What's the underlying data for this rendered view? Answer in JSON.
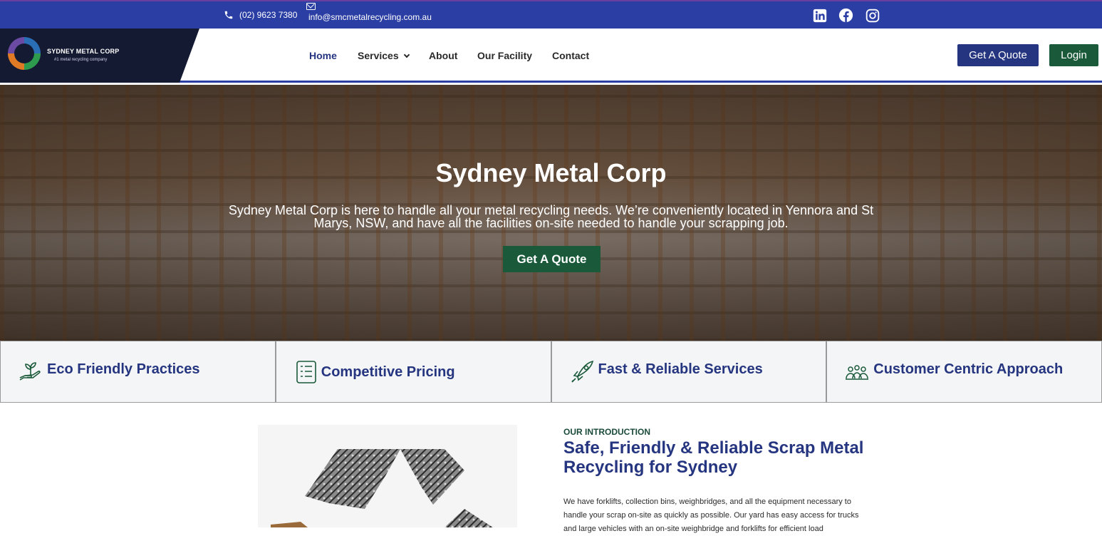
{
  "topbar": {
    "phone": "(02) 9623 7380",
    "email": "info@smcmetalrecycling.com.au",
    "social": [
      "linkedin-icon",
      "facebook-icon",
      "instagram-icon"
    ]
  },
  "header": {
    "logo_name": "SYDNEY METAL CORP",
    "logo_tagline": "#1 metal recycling company",
    "nav": {
      "home": "Home",
      "services": "Services",
      "about": "About",
      "facility": "Our Facility",
      "contact": "Contact"
    },
    "quote_button": "Get A Quote",
    "login_button": "Login"
  },
  "hero": {
    "title": "Sydney Metal Corp",
    "text": "Sydney Metal Corp is here to handle all your metal recycling needs. We’re conveniently located in Yennora and St Marys, NSW, and have all the facilities on-site needed to handle your scrapping job.",
    "button": "Get A Quote"
  },
  "features": [
    {
      "label": "Eco Friendly Practices",
      "icon": "eco-plant-icon"
    },
    {
      "label": "Competitive Pricing",
      "icon": "price-list-icon"
    },
    {
      "label": "Fast & Reliable Services",
      "icon": "rocket-icon"
    },
    {
      "label": "Customer Centric Approach",
      "icon": "customers-icon"
    }
  ],
  "intro": {
    "eyebrow": "OUR INTRODUCTION",
    "title": "Safe, Friendly & Reliable Scrap Metal Recycling for Sydney",
    "body": "We have forklifts, collection bins, weighbridges, and all the equipment necessary to handle your scrap on-site as quickly as possible. Our yard has easy access for trucks and large vehicles with an on-site weighbridge and forklifts for efficient load"
  },
  "colors": {
    "topbar": "#2b3ea4",
    "brand_blue": "#25357f",
    "brand_green": "#1a5a3a",
    "logo_dark": "#151a33"
  }
}
